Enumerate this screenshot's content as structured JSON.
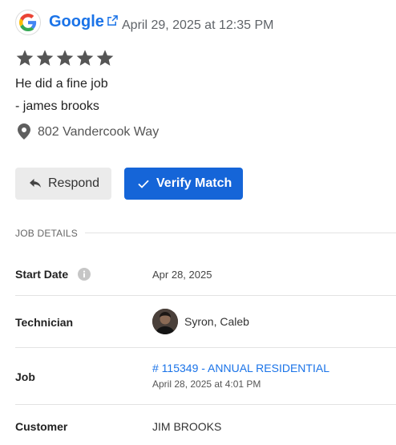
{
  "review": {
    "source": "Google",
    "source_icon": "google-logo",
    "date": "April 29, 2025 at 12:35 PM",
    "rating": 5,
    "rating_max": 5,
    "text": "He did a fine job",
    "reviewer": "- james brooks",
    "address": "802 Vandercook Way"
  },
  "actions": {
    "respond_label": "Respond",
    "verify_label": "Verify Match"
  },
  "job_details": {
    "section_title": "JOB DETAILS",
    "start_date_label": "Start Date",
    "start_date_value": "Apr 28, 2025",
    "technician_label": "Technician",
    "technician_name": "Syron, Caleb",
    "job_label": "Job",
    "job_link": "# 115349 - ANNUAL RESIDENTIAL",
    "job_date": "April 28, 2025 at 4:01 PM",
    "customer_label": "Customer",
    "customer_value": "JIM BROOKS"
  },
  "colors": {
    "accent": "#1565d8",
    "link": "#1a73e8",
    "star": "#555555",
    "respond_bg": "#ebebeb"
  }
}
